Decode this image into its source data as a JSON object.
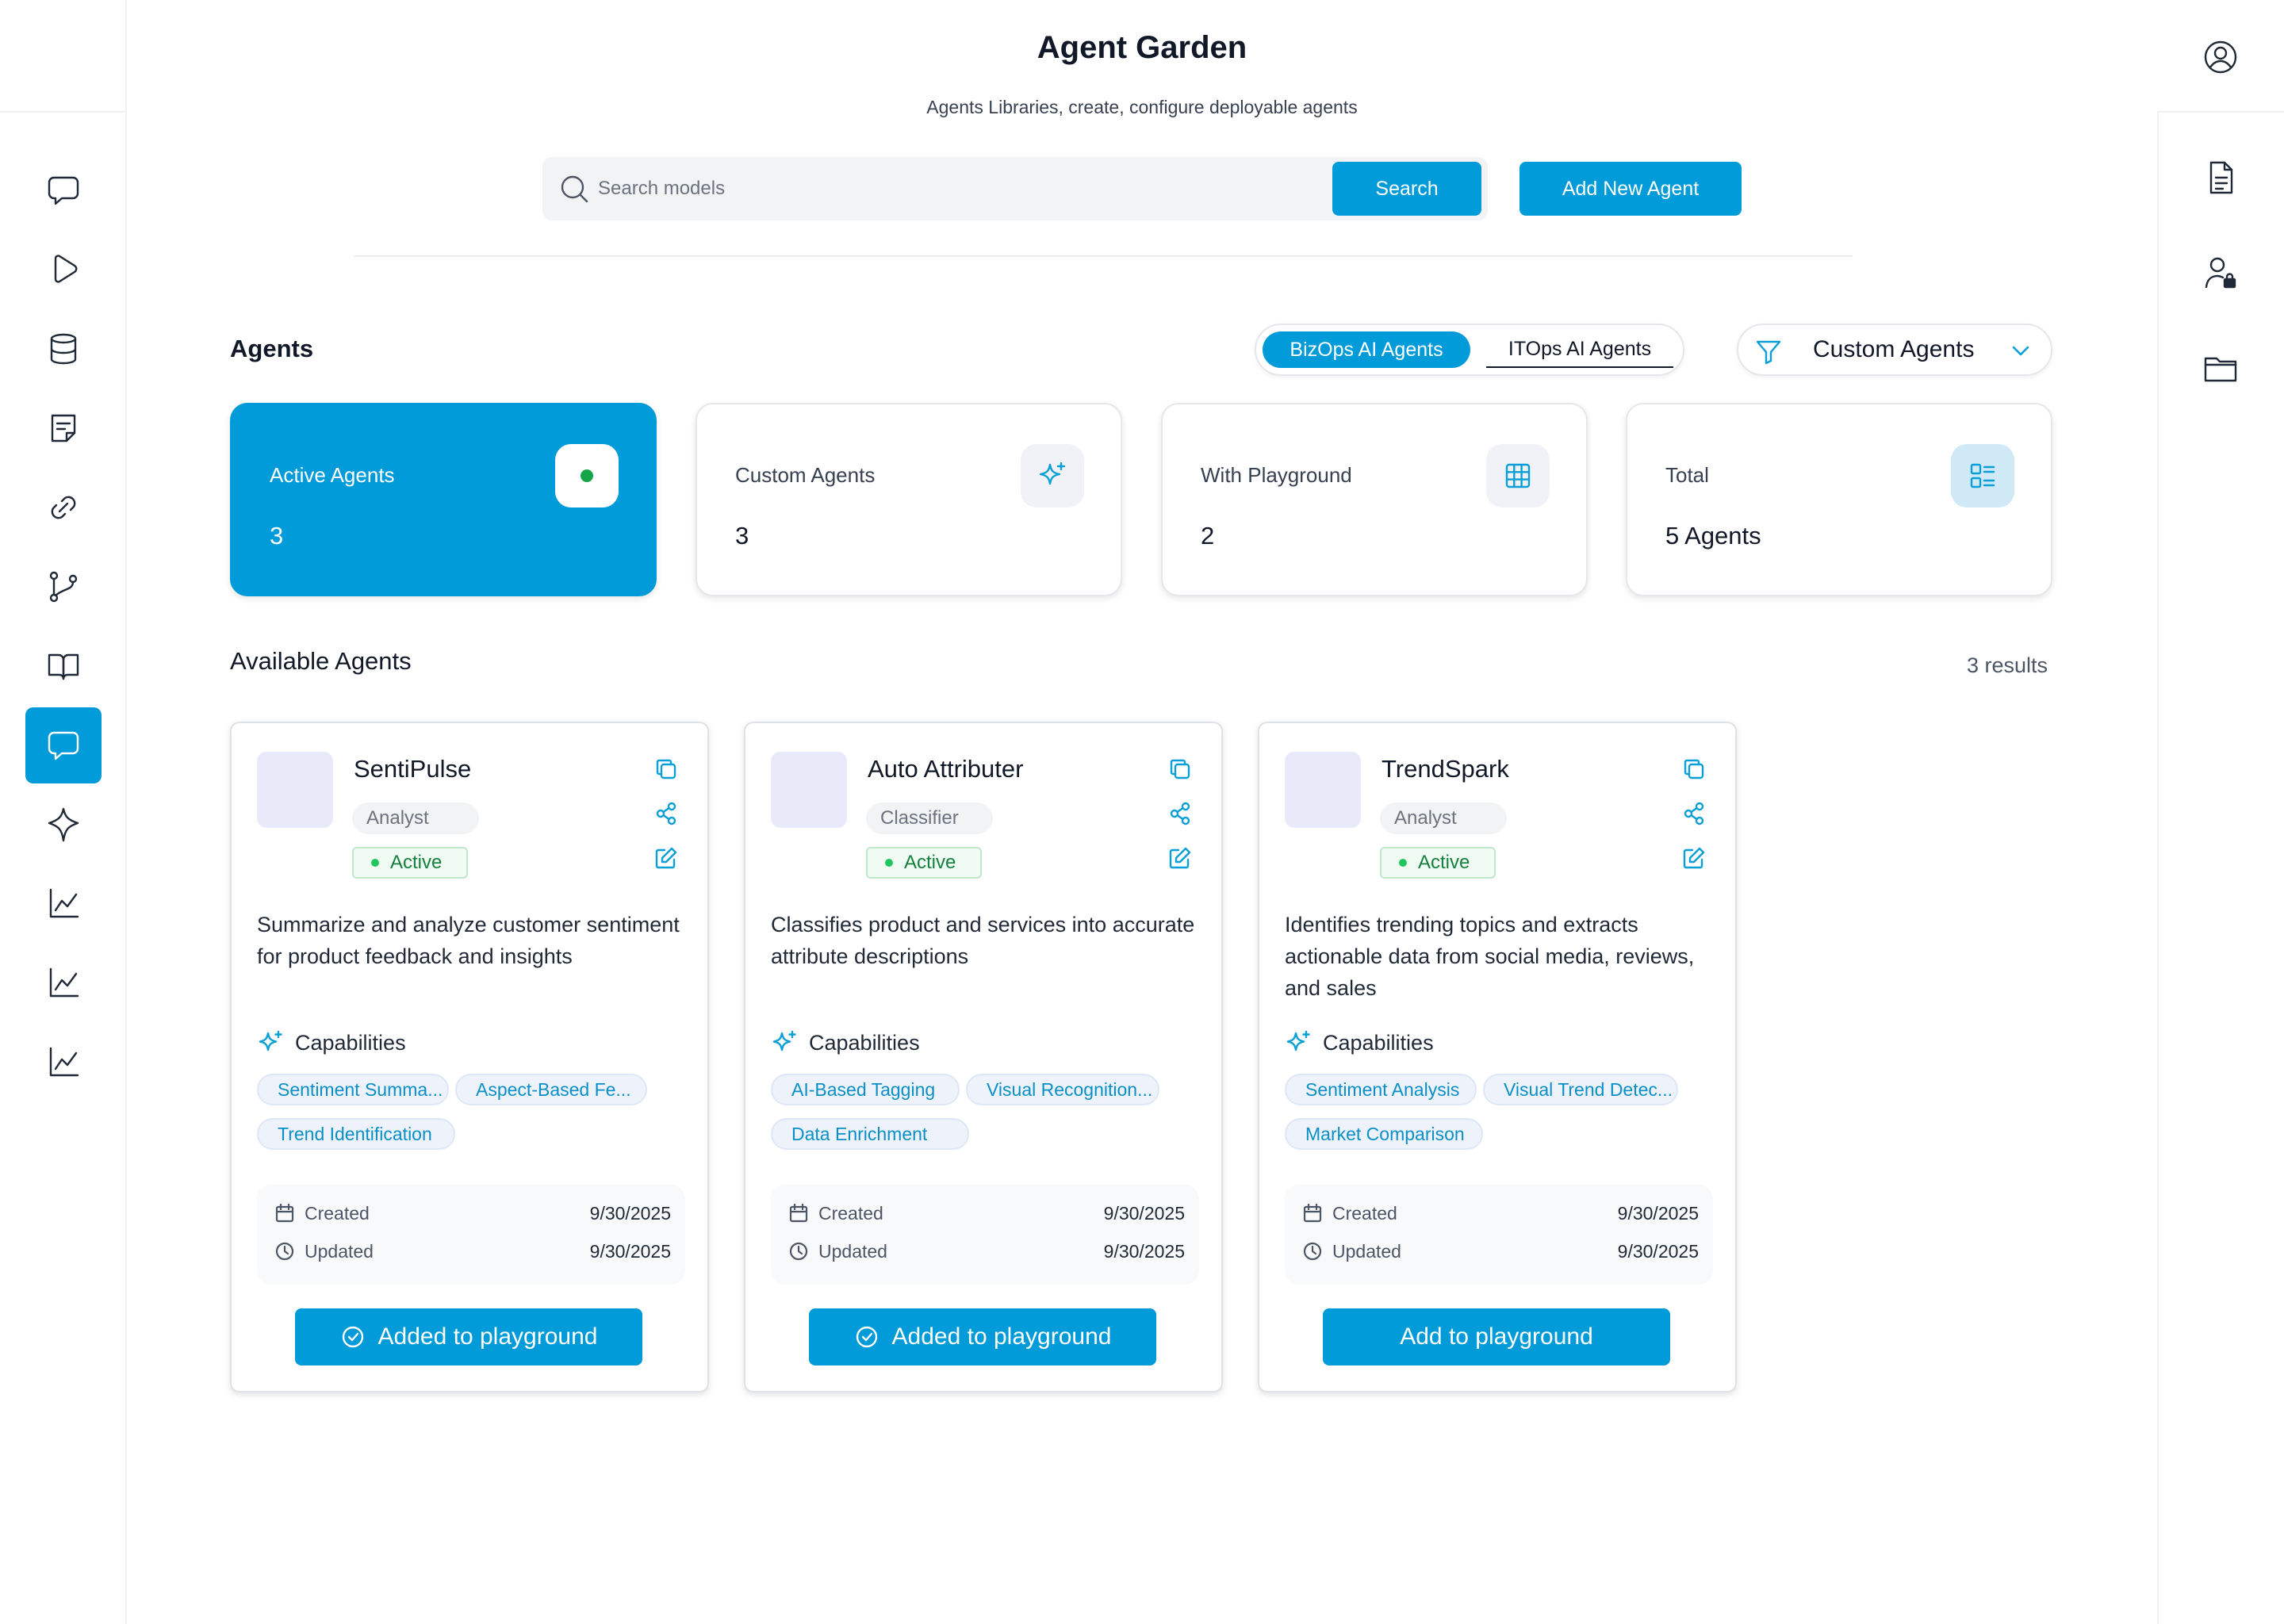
{
  "header": {
    "title": "Agent Garden",
    "subtitle": "Agents Libraries, create, configure deployable agents",
    "search_placeholder": "Search models",
    "search_label": "Search",
    "add_label": "Add New Agent"
  },
  "left_nav": {
    "items": [
      {
        "icon": "chat-icon"
      },
      {
        "icon": "play-icon"
      },
      {
        "icon": "database-icon"
      },
      {
        "icon": "note-icon"
      },
      {
        "icon": "link-icon"
      },
      {
        "icon": "git-branch-icon"
      },
      {
        "icon": "book-icon"
      },
      {
        "icon": "chat-icon",
        "active": true
      },
      {
        "icon": "sparkle-icon"
      },
      {
        "icon": "chart-icon"
      },
      {
        "icon": "chart-icon"
      },
      {
        "icon": "chart-icon"
      }
    ]
  },
  "right_nav": {
    "items": [
      {
        "icon": "document-icon"
      },
      {
        "icon": "user-lock-icon"
      },
      {
        "icon": "folder-icon"
      }
    ]
  },
  "agents_section": {
    "title": "Agents",
    "toggle": [
      "BizOps AI Agents",
      "ITOps AI Agents"
    ],
    "toggle_selected": "BizOps AI Agents",
    "filter_label": "Custom Agents"
  },
  "stats": [
    {
      "label": "Active Agents",
      "value": "3",
      "icon": "status-dot-icon"
    },
    {
      "label": "Custom Agents",
      "value": "3",
      "icon": "sparkle-icon"
    },
    {
      "label": "With Playground",
      "value": "2",
      "icon": "grid-icon"
    },
    {
      "label": "Total",
      "value": "5 Agents",
      "icon": "list-icon"
    }
  ],
  "available": {
    "title": "Available Agents",
    "results": "3 results"
  },
  "cards": [
    {
      "name": "SentiPulse",
      "role": "Analyst",
      "status": "Active",
      "description": "Summarize and analyze customer sentiment for product feedback and insights",
      "capabilities_label": "Capabilities",
      "capabilities": [
        "Sentiment Summa...",
        "Aspect-Based Fe...",
        "Trend Identification"
      ],
      "created_label": "Created",
      "created": "9/30/2025",
      "updated_label": "Updated",
      "updated": "9/30/2025",
      "button": "Added to playground",
      "added": true
    },
    {
      "name": "Auto Attributer",
      "role": "Classifier",
      "status": "Active",
      "description": "Classifies product and services into accurate attribute descriptions",
      "capabilities_label": "Capabilities",
      "capabilities": [
        "AI-Based Tagging",
        "Visual Recognition...",
        "Data Enrichment"
      ],
      "created_label": "Created",
      "created": "9/30/2025",
      "updated_label": "Updated",
      "updated": "9/30/2025",
      "button": "Added to playground",
      "added": true
    },
    {
      "name": "TrendSpark",
      "role": "Analyst",
      "status": "Active",
      "description": "Identifies trending topics and extracts actionable data from social media, reviews, and sales",
      "capabilities_label": "Capabilities",
      "capabilities": [
        "Sentiment Analysis",
        "Visual Trend Detec...",
        "Market Comparison"
      ],
      "created_label": "Created",
      "created": "9/30/2025",
      "updated_label": "Updated",
      "updated": "9/30/2025",
      "button": "Add to playground",
      "added": false
    }
  ],
  "colors": {
    "accent": "#009bd8",
    "active_status": "#15803d"
  }
}
